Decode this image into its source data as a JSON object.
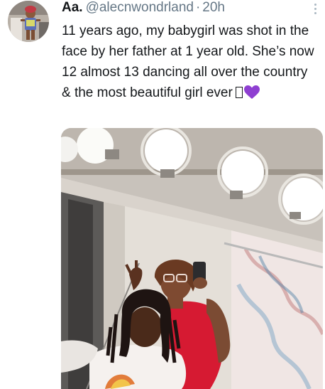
{
  "tweet": {
    "display_name": "Aa.",
    "handle": "@alecnwondrland",
    "separator": "·",
    "time": "20h",
    "text": "11 years ago, my babygirl was shot in the face by her father at 1 year old. She’s now 12 almost 13 dancing all over the country & the most beautiful girl ever",
    "emoji": [
      "purple-heart-icon"
    ],
    "media": {
      "kind": "photo",
      "subject": "two girls taking a mirror selfie"
    }
  },
  "colors": {
    "text": "#14171a",
    "secondary": "#657786",
    "heart": "#8e3fd1"
  }
}
